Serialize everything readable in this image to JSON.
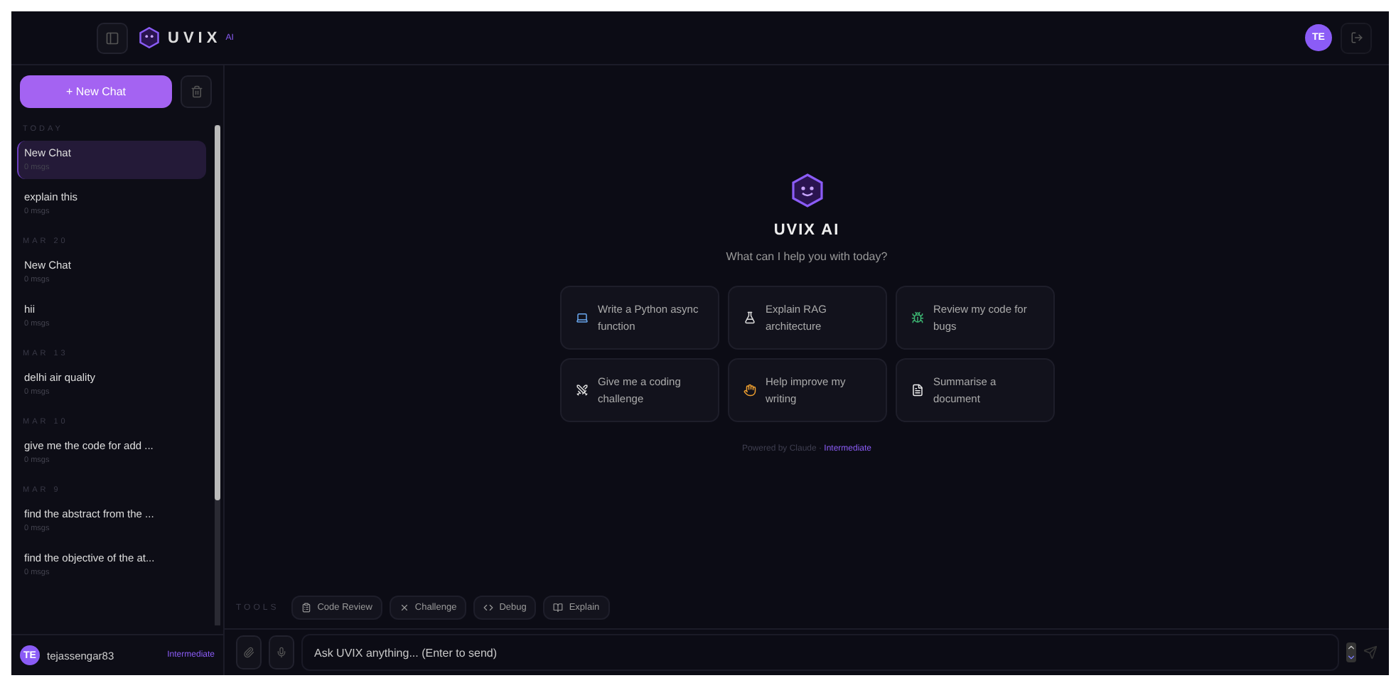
{
  "header": {
    "brand": "UVIX",
    "badge": "AI",
    "avatar": "TE"
  },
  "sidebar": {
    "new_chat": "+ New Chat",
    "groups": [
      {
        "label": "TODAY",
        "chats": [
          {
            "title": "New Chat",
            "meta": "0 msgs",
            "selected": true
          },
          {
            "title": "explain this",
            "meta": "0 msgs",
            "selected": false
          }
        ]
      },
      {
        "label": "MAR 20",
        "chats": [
          {
            "title": "New Chat",
            "meta": "0 msgs",
            "selected": false
          },
          {
            "title": "hii",
            "meta": "0 msgs",
            "selected": false
          }
        ]
      },
      {
        "label": "MAR 13",
        "chats": [
          {
            "title": "delhi air quality",
            "meta": "0 msgs",
            "selected": false
          }
        ]
      },
      {
        "label": "MAR 10",
        "chats": [
          {
            "title": "give me the code for add ...",
            "meta": "0 msgs",
            "selected": false
          }
        ]
      },
      {
        "label": "MAR 9",
        "chats": [
          {
            "title": "find the abstract from the ...",
            "meta": "0 msgs",
            "selected": false
          },
          {
            "title": "find the objective of the at...",
            "meta": "0 msgs",
            "selected": false
          }
        ]
      }
    ],
    "user": {
      "avatar": "TE",
      "name": "tejassengar83",
      "level": "Intermediate"
    }
  },
  "main": {
    "title": "UVIX AI",
    "subtitle": "What can I help you with today?",
    "suggestions": [
      {
        "kind": "laptop",
        "text": "Write a Python async function"
      },
      {
        "kind": "flask",
        "text": "Explain RAG architecture"
      },
      {
        "kind": "bug",
        "text": "Review my code for bugs"
      },
      {
        "kind": "swords",
        "text": "Give me a coding challenge"
      },
      {
        "kind": "hand",
        "text": "Help improve my writing"
      },
      {
        "kind": "document",
        "text": "Summarise a document"
      }
    ],
    "powered_by": "Powered by Claude · ",
    "mode": "Intermediate"
  },
  "tools": {
    "label": "TOOLS",
    "items": [
      {
        "kind": "review",
        "label": "Code Review"
      },
      {
        "kind": "challenge",
        "label": "Challenge"
      },
      {
        "kind": "debug",
        "label": "Debug"
      },
      {
        "kind": "explain",
        "label": "Explain"
      }
    ]
  },
  "composer": {
    "placeholder": "Ask UVIX anything... (Enter to send)"
  }
}
